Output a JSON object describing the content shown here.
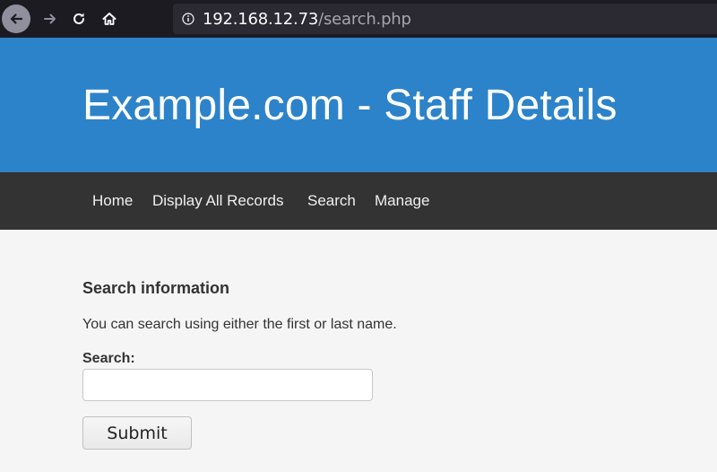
{
  "browser": {
    "url_host": "192.168.12.73",
    "url_path": "/search.php",
    "back_icon": "arrow-left-icon",
    "forward_icon": "arrow-right-icon",
    "reload_icon": "reload-icon",
    "home_icon": "home-icon",
    "info_icon": "info-icon"
  },
  "header": {
    "title": "Example.com - Staff Details",
    "color": "#2d83c9"
  },
  "nav": {
    "items": [
      {
        "label": "Home"
      },
      {
        "label": "Display All Records"
      },
      {
        "label": "Search"
      },
      {
        "label": "Manage"
      }
    ],
    "color": "#333333"
  },
  "main": {
    "heading": "Search information",
    "help": "You can search using either the first or last name.",
    "search_label": "Search:",
    "search_value": "",
    "submit_label": "Submit"
  }
}
